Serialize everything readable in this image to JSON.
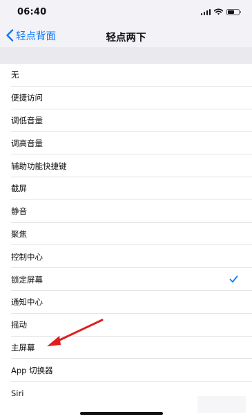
{
  "status_bar": {
    "time": "06:40",
    "battery_level": 0.6,
    "icons": [
      "cellular-signal-icon",
      "wifi-icon",
      "battery-icon"
    ]
  },
  "nav": {
    "back_label": "轻点背面",
    "title": "轻点两下"
  },
  "options": [
    {
      "label": "无",
      "selected": false
    },
    {
      "label": "便捷访问",
      "selected": false
    },
    {
      "label": "调低音量",
      "selected": false
    },
    {
      "label": "调高音量",
      "selected": false
    },
    {
      "label": "辅助功能快捷键",
      "selected": false
    },
    {
      "label": "截屏",
      "selected": false
    },
    {
      "label": "静音",
      "selected": false
    },
    {
      "label": "聚焦",
      "selected": false
    },
    {
      "label": "控制中心",
      "selected": false
    },
    {
      "label": "锁定屏幕",
      "selected": true
    },
    {
      "label": "通知中心",
      "selected": false
    },
    {
      "label": "摇动",
      "selected": false
    },
    {
      "label": "主屏幕",
      "selected": false
    },
    {
      "label": "App 切换器",
      "selected": false
    },
    {
      "label": "Siri",
      "selected": false
    }
  ],
  "colors": {
    "accent": "#0a7aff",
    "annotation_arrow": "#e11d1d",
    "group_background": "#e9e9ee",
    "bar_background": "#f2f2f7"
  }
}
